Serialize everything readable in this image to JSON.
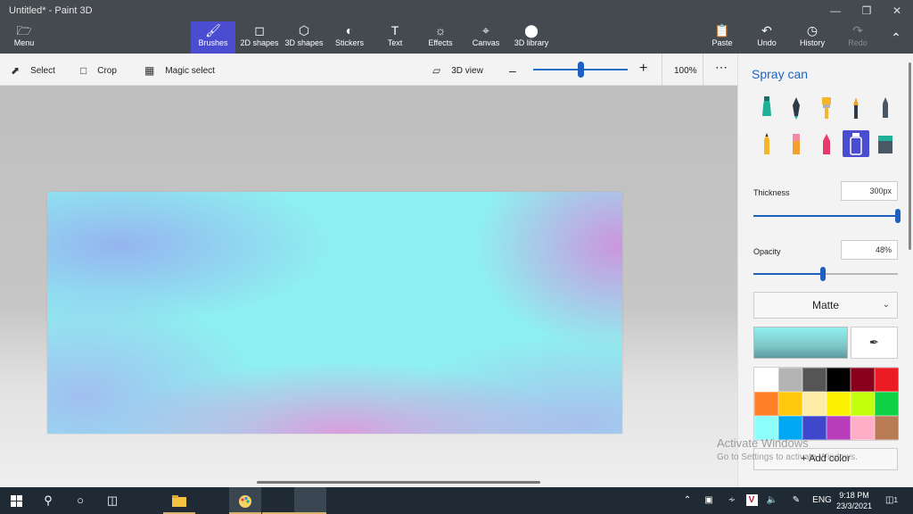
{
  "window": {
    "title": "Untitled* - Paint 3D"
  },
  "menu": {
    "label": "Menu"
  },
  "ribbon": [
    {
      "label": "Brushes",
      "icon": "brush-icon"
    },
    {
      "label": "2D shapes",
      "icon": "2d-shapes-icon"
    },
    {
      "label": "3D shapes",
      "icon": "3d-shapes-icon"
    },
    {
      "label": "Stickers",
      "icon": "stickers-icon"
    },
    {
      "label": "Text",
      "icon": "text-icon"
    },
    {
      "label": "Effects",
      "icon": "effects-icon"
    },
    {
      "label": "Canvas",
      "icon": "canvas-icon"
    },
    {
      "label": "3D library",
      "icon": "3d-library-icon"
    }
  ],
  "ribbon_right": [
    {
      "label": "Paste",
      "icon": "paste-icon"
    },
    {
      "label": "Undo",
      "icon": "undo-icon"
    },
    {
      "label": "History",
      "icon": "history-icon"
    },
    {
      "label": "Redo",
      "icon": "redo-icon"
    }
  ],
  "toolbar": {
    "select": "Select",
    "crop": "Crop",
    "magic_select": "Magic select",
    "view_3d": "3D view",
    "zoom": "100%",
    "zoom_fraction": 0.5
  },
  "panel": {
    "title": "Spray can",
    "thickness_label": "Thickness",
    "thickness_value": "300px",
    "thickness_fraction": 1.0,
    "opacity_label": "Opacity",
    "opacity_value": "48%",
    "opacity_fraction": 0.48,
    "finish": "Matte",
    "add_color": "Add color",
    "current_color": "#8feeee",
    "palette": [
      "#ffffff",
      "#b4b4b4",
      "#555555",
      "#000000",
      "#88001b",
      "#ec1c24",
      "#ff7f27",
      "#ffc90e",
      "#fdeca6",
      "#fff200",
      "#c4ff0e",
      "#0ed145",
      "#8cfffb",
      "#00a8f3",
      "#3f48cc",
      "#b83dba",
      "#ffaec8",
      "#b97a56"
    ]
  },
  "watermark": {
    "line1": "Activate Windows",
    "line2": "Go to Settings to activate Windows."
  },
  "taskbar": {
    "language": "ENG",
    "time": "9:18 PM",
    "date": "23/3/2021",
    "notification_count": "1"
  }
}
